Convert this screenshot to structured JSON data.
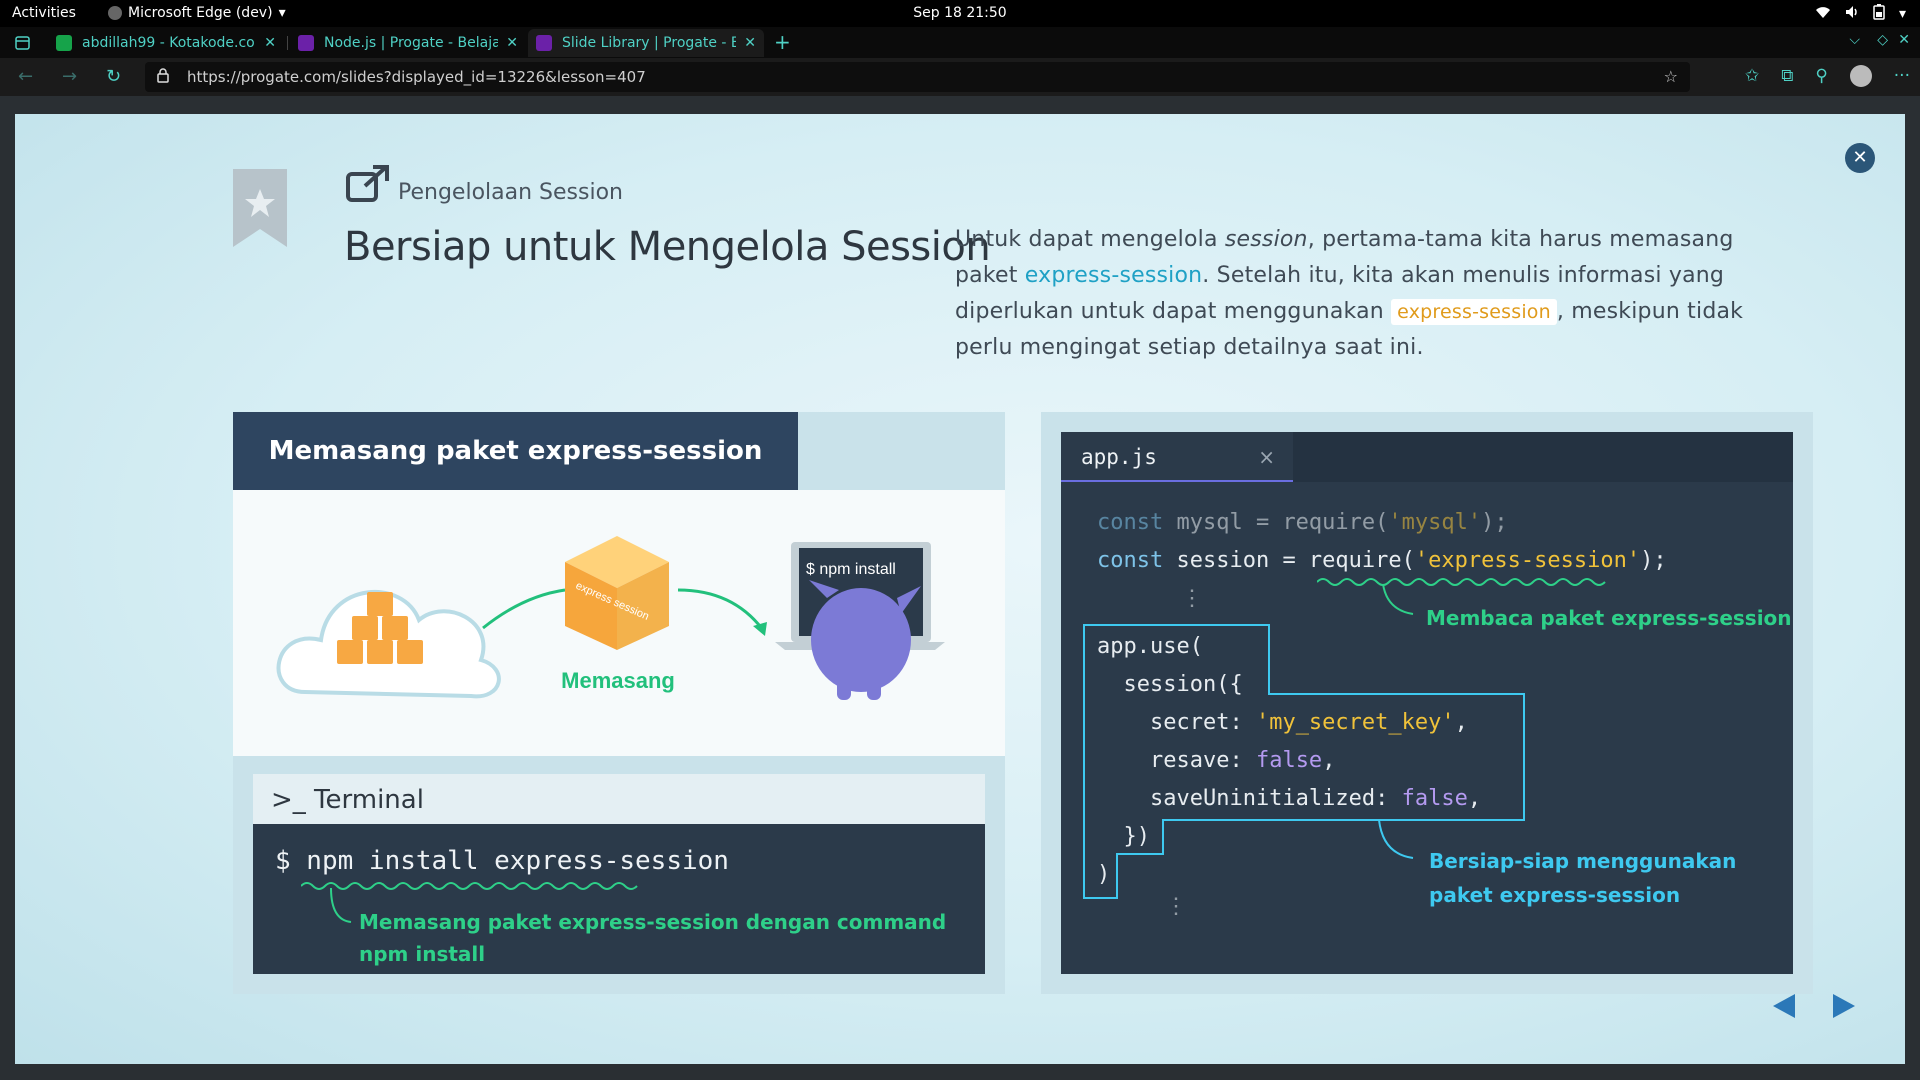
{
  "system": {
    "activities": "Activities",
    "app_name": "Microsoft Edge (dev)",
    "clock": "Sep 18  21:50"
  },
  "tabs": [
    {
      "title": "abdillah99 - Kotakode.com",
      "favicon_color": "#16a34a"
    },
    {
      "title": "Node.js | Progate - Belajar",
      "favicon_color": "#6b21a8"
    },
    {
      "title": "Slide Library | Progate - B",
      "favicon_color": "#6b21a8"
    }
  ],
  "address": {
    "url": "https://progate.com/slides?displayed_id=13226&lesson=407"
  },
  "slide": {
    "section": "Pengelolaan Session",
    "title": "Bersiap untuk Mengelola Session",
    "desc": {
      "p1": "Untuk dapat mengelola ",
      "em": "session",
      "p2": ", pertama-tama kita harus memasang paket ",
      "link": "express-session",
      "p3": ". Setelah itu, kita akan menulis informasi yang diperlukan untuk dapat menggunakan ",
      "code": "express-session",
      "p4": ", meskipun tidak perlu mengingat setiap detailnya saat ini."
    },
    "left_panel": {
      "header": "Memasang paket express-session",
      "illustration": {
        "box_label": "express session",
        "arrow_label": "Memasang",
        "laptop_text": "$ npm install"
      },
      "terminal": {
        "title": ">_ Terminal",
        "command": "$ npm install express-session",
        "note": "Memasang paket express-session dengan command npm install"
      }
    },
    "right_panel": {
      "tab_name": "app.js",
      "tab_close": "×",
      "note_require": "Membaca paket express-session",
      "note_use": "Bersiap-siap menggunakan paket express-session",
      "colors": {
        "keyword": "#7ec3e8",
        "string": "#f0c23a",
        "boolean": "#b49af0",
        "note_green": "#2ed089",
        "note_cyan": "#3ec9f0"
      }
    }
  }
}
